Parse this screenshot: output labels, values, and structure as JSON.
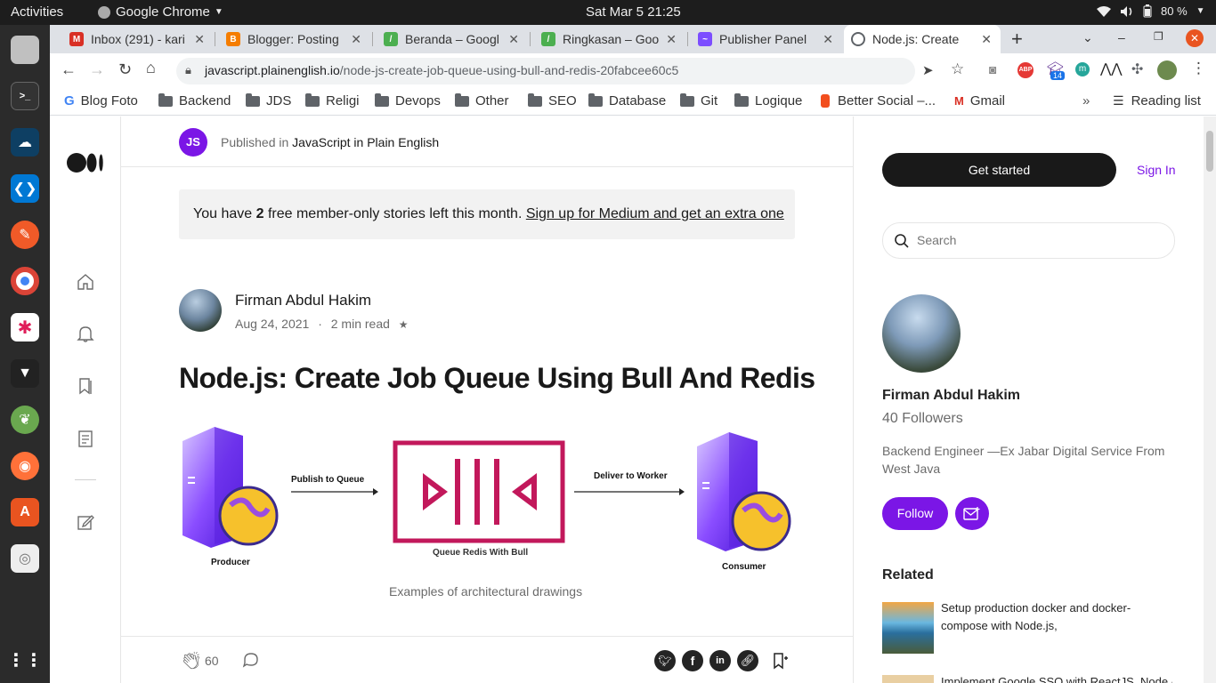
{
  "system": {
    "activities": "Activities",
    "app_name": "Google Chrome",
    "clock": "Sat Mar 5  21:25",
    "battery": "80 %"
  },
  "tabs": [
    {
      "label": "Inbox (291) - kari",
      "favicon": "gmail-icon",
      "color": "#d93025"
    },
    {
      "label": "Blogger: Posting",
      "favicon": "blogger-icon",
      "color": "#f57d00"
    },
    {
      "label": "Beranda – Googl",
      "favicon": "adsense-icon",
      "color": "#4caf50"
    },
    {
      "label": "Ringkasan – Goo",
      "favicon": "adsense-icon",
      "color": "#4caf50"
    },
    {
      "label": "Publisher Panel",
      "favicon": "publisher-icon",
      "color": "#7c4dff"
    },
    {
      "label": "Node.js: Create",
      "favicon": "globe-icon",
      "color": "#5f6368"
    }
  ],
  "address": {
    "domain": "javascript.plainenglish.io",
    "path": "/node-js-create-job-queue-using-bull-and-redis-20fabcee60c5"
  },
  "extensions": {
    "abp": "ABP",
    "badge": "14",
    "m": "m"
  },
  "bookmarks": [
    {
      "label": "Blog Foto",
      "type": "google"
    },
    {
      "label": "Backend",
      "type": "folder"
    },
    {
      "label": "JDS",
      "type": "folder"
    },
    {
      "label": "Religi",
      "type": "folder"
    },
    {
      "label": "Devops",
      "type": "folder"
    },
    {
      "label": "Other",
      "type": "folder"
    },
    {
      "label": "SEO",
      "type": "folder"
    },
    {
      "label": "Database",
      "type": "folder"
    },
    {
      "label": "Git",
      "type": "folder"
    },
    {
      "label": "Logique",
      "type": "folder"
    },
    {
      "label": "Better Social –...",
      "type": "figma"
    },
    {
      "label": "Gmail",
      "type": "gmail"
    }
  ],
  "reading_list": "Reading list",
  "publication": {
    "badge": "JS",
    "prefix": "Published in",
    "name": "JavaScript in Plain English"
  },
  "paywall": {
    "before": "You have ",
    "count": "2",
    "after": " free member-only stories left this month. ",
    "link": "Sign up for Medium and get an extra one"
  },
  "author": {
    "name": "Firman Abdul Hakim",
    "date": "Aug 24, 2021",
    "dot": "·",
    "read_time": "2 min read",
    "star": "★"
  },
  "article": {
    "title": "Node.js: Create Job Queue Using Bull And Redis",
    "caption": "Examples of architectural drawings"
  },
  "diagram": {
    "producer": "Producer",
    "publish": "Publish to Queue",
    "queue": "Queue Redis With Bull",
    "deliver": "Deliver to Worker",
    "consumer": "Consumer"
  },
  "footer": {
    "claps": "60"
  },
  "sidebar": {
    "get_started": "Get started",
    "sign_in": "Sign In",
    "search_placeholder": "Search",
    "author_name": "Firman Abdul Hakim",
    "followers": "40 Followers",
    "bio": "Backend Engineer —Ex Jabar Digital Service From West Java",
    "follow": "Follow",
    "related_title": "Related",
    "related": [
      "Setup production docker and docker-compose with Node.js,",
      "Implement Google SSO with ReactJS, Node /"
    ]
  },
  "colors": {
    "accent": "#7b16e6",
    "dark": "#191919",
    "queue": "#c2185b"
  }
}
